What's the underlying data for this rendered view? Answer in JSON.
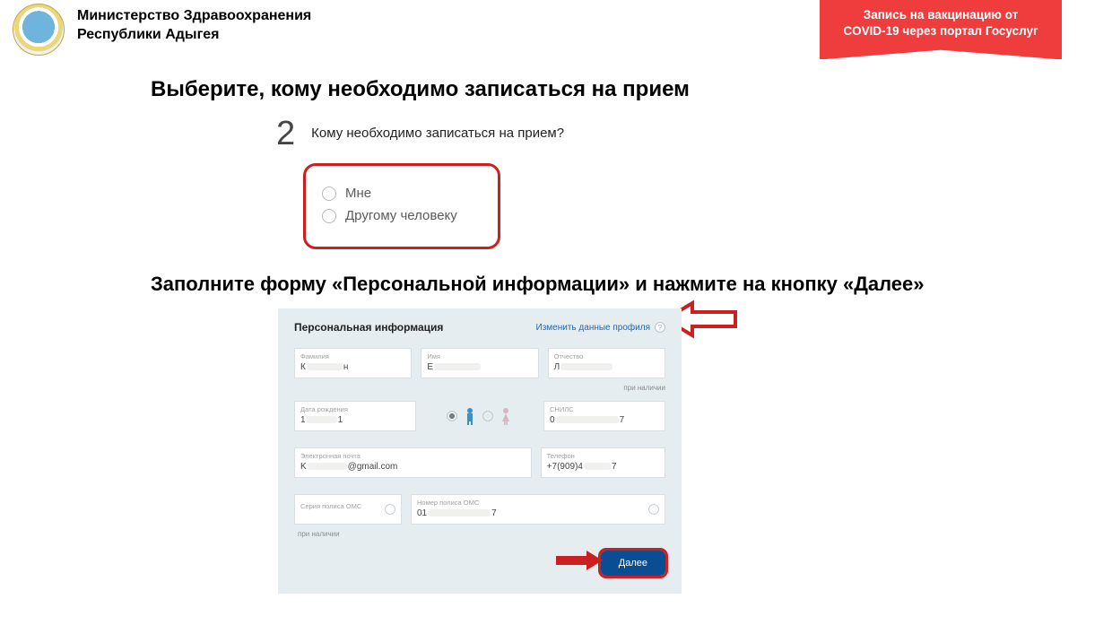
{
  "header": {
    "org_line1": "Министерство Здравоохранения",
    "org_line2": "Республики Адыгея",
    "badge_line1": "Запись на вакцинацию от",
    "badge_line2": "COVID-19 через портал Госуслуг"
  },
  "step1": {
    "title": "Выберите, кому необходимо записаться на прием",
    "number": "2",
    "question": "Кому необходимо записаться на прием?",
    "opt_me": "Мне",
    "opt_other": "Другому человеку"
  },
  "step2": {
    "title": "Заполните форму «Персональной информации» и нажмите на кнопку «Далее»"
  },
  "panel": {
    "title": "Персональная информация",
    "edit_link": "Изменить данные профиля",
    "fields": {
      "lastname_label": "Фамилия",
      "lastname_value_a": "К",
      "lastname_value_b": "н",
      "firstname_label": "Имя",
      "firstname_value_a": "Е",
      "patronym_label": "Отчество",
      "patronym_value_a": "Л",
      "hint_optional": "при наличии",
      "dob_label": "Дата рождения",
      "dob_value_a": "1",
      "dob_value_b": "1",
      "snils_label": "СНИЛС",
      "snils_value_a": "0",
      "snils_value_b": "7",
      "email_label": "Электронная почта",
      "email_value_a": "K",
      "email_value_b": "@gmail.com",
      "phone_label": "Телефон",
      "phone_value_a": "+7(909)4",
      "phone_value_b": "7",
      "oms_series_label": "Серия полиса ОМС",
      "oms_number_label": "Номер полиса ОМС",
      "oms_number_value_a": "01",
      "oms_number_value_b": "7"
    },
    "next_button": "Далее"
  }
}
